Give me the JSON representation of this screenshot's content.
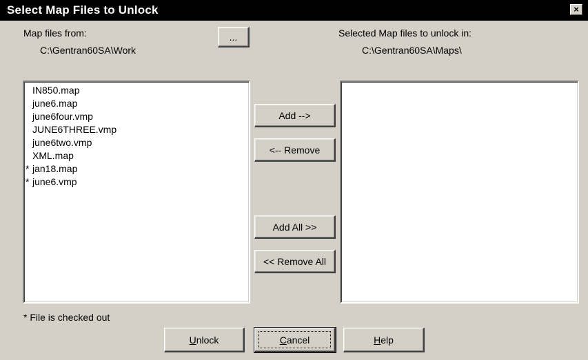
{
  "window": {
    "title": "Select Map Files to Unlock",
    "close_glyph": "×"
  },
  "source": {
    "label": "Map files from:",
    "path": "C:\\Gentran60SA\\Work",
    "browse_label": "..."
  },
  "target": {
    "label": "Selected Map files to unlock in:",
    "path": "C:\\Gentran60SA\\Maps\\"
  },
  "available_files": [
    {
      "mark": "",
      "name": "IN850.map"
    },
    {
      "mark": "",
      "name": "june6.map"
    },
    {
      "mark": "",
      "name": "june6four.vmp"
    },
    {
      "mark": "",
      "name": "JUNE6THREE.vmp"
    },
    {
      "mark": "",
      "name": "june6two.vmp"
    },
    {
      "mark": "",
      "name": "XML.map"
    },
    {
      "mark": "*",
      "name": "jan18.map"
    },
    {
      "mark": "*",
      "name": "june6.vmp"
    }
  ],
  "selected_files": [],
  "buttons": {
    "add": "Add -->",
    "remove": "<-- Remove",
    "add_all": "Add All  >>",
    "remove_all": "<< Remove All",
    "unlock_prefix": "",
    "unlock_hotkey": "U",
    "unlock_rest": "nlock",
    "cancel_hotkey": "C",
    "cancel_rest": "ancel",
    "help_hotkey": "H",
    "help_rest": "elp"
  },
  "footnote": "* File is checked out",
  "colors": {
    "dialog_bg": "#d4d0c8",
    "titlebar_bg": "#000000",
    "titlebar_text": "#ffffff"
  }
}
